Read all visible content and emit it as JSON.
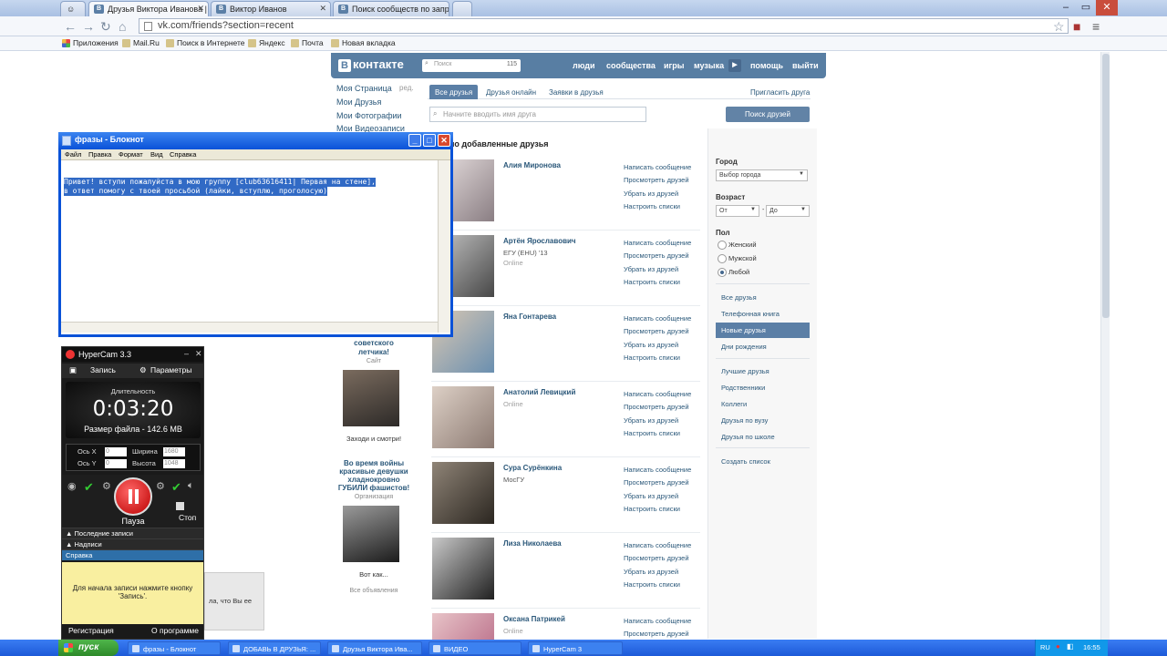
{
  "browser": {
    "tabs": [
      {
        "label": "Друзья Виктора Иванова |",
        "active": true
      },
      {
        "label": "Виктор Иванов",
        "active": false
      },
      {
        "label": "Поиск сообществ по запро",
        "active": false
      }
    ],
    "url": "vk.com/friends?section=recent",
    "bookmarks": [
      "Приложения",
      "Mail.Ru",
      "Поиск в Интернете",
      "Яндекс",
      "Почта",
      "Новая вкладка"
    ]
  },
  "vk": {
    "logo": "контакте",
    "logo_letter": "В",
    "search_placeholder": "Поиск",
    "search_count": "115",
    "nav": [
      "люди",
      "сообщества",
      "игры",
      "музыка",
      "помощь",
      "выйти"
    ],
    "left_menu": {
      "my_page": "Моя Страница",
      "edit": "ред.",
      "friends": "Мои Друзья",
      "photos": "Мои Фотографии",
      "videos": "Мои Видеозаписи"
    },
    "tabs": [
      "Все друзья",
      "Друзья онлайн",
      "Заявки в друзья"
    ],
    "invite": "Пригласить друга",
    "friend_search_placeholder": "Начните вводить имя друга",
    "search_button": "Поиск друзей",
    "recent_title": "но добавленные друзья",
    "actions": [
      "Написать сообщение",
      "Просмотреть друзей",
      "Убрать из друзей",
      "Настроить списки"
    ],
    "friends": [
      {
        "name": "Алия Миронова",
        "sub1": "",
        "sub2": ""
      },
      {
        "name": "Артён Ярославович",
        "sub1": "ЕГУ (EHU) '13",
        "sub2": "Online"
      },
      {
        "name": "Яна Гонтарева",
        "sub1": "",
        "sub2": ""
      },
      {
        "name": "Анатолий Левицкий",
        "sub1": "Online",
        "sub2": ""
      },
      {
        "name": "Сура Сурёнкина",
        "sub1": "МосГУ",
        "sub2": ""
      },
      {
        "name": "Лиза Николаева",
        "sub1": "",
        "sub2": ""
      },
      {
        "name": "Оксана Патрикей",
        "sub1": "Online",
        "sub2": ""
      }
    ],
    "filters": {
      "city_label": "Город",
      "city_value": "Выбор города",
      "age_label": "Возраст",
      "age_from": "От",
      "age_to": "До",
      "age_dash": "-",
      "sex_label": "Пол",
      "sex_options": [
        "Женский",
        "Мужской",
        "Любой"
      ],
      "sex_selected": "Любой",
      "categories_a": [
        "Все друзья",
        "Телефонная книга",
        "Новые друзья",
        "Дни рождения"
      ],
      "categories_b": [
        "Лучшие друзья",
        "Родственники",
        "Коллеги",
        "Друзья по вузу",
        "Друзья по школе"
      ],
      "create_list": "Создать список",
      "active_category": "Новые друзья"
    },
    "ads": {
      "ad1_title1": "советского",
      "ad1_title2": "летчика!",
      "ad1_sub": "Сайт",
      "ad1_link": "Заходи и смотри!",
      "ad2_title": "Во время войны красивые девушки хладнокровно ГУБИЛИ фашистов!",
      "ad2_sub": "Организация",
      "ad2_link": "Вот как...",
      "all_ads": "Все объявления"
    }
  },
  "notepad": {
    "title": "фразы - Блокнот",
    "menu": [
      "Файл",
      "Правка",
      "Формат",
      "Вид",
      "Справка"
    ],
    "line1": "Привет! вступи пожалуйста в мою группу [club63616411| Первая на стене],",
    "line2": "в ответ помогу с твоей просьбой (лайки, вступлю, проголосую)"
  },
  "hypercam": {
    "title": "HyperCam 3.3",
    "tab_record": "Запись",
    "tab_params": "Параметры",
    "duration_label": "Длительность",
    "timer": "0:03:20",
    "file_size": "Размер файла - 142.6 MB",
    "axis_x": "Ось X",
    "axis_y": "Ось Y",
    "x_value": "0",
    "y_value": "0",
    "width_label": "Ширина",
    "height_label": "Высота",
    "width_value": "1680",
    "height_value": "1048",
    "pause": "Пауза",
    "stop": "Стоп",
    "recent": "Последние записи",
    "captions": "Надписи",
    "help": "Справка",
    "hint": "Для начала записи нажмите кнопку 'Запись'.",
    "register": "Регистрация",
    "about": "О программе"
  },
  "tooltip_fragment": "ла, что Вы ее",
  "taskbar": {
    "start": "пуск",
    "tasks": [
      "фразы - Блокнот",
      "ДОБАВЬ В ДРУЗЬЯ: ...",
      "Друзья Виктора Ива...",
      "ВИДЕО",
      "HyperCam 3"
    ],
    "lang": "RU",
    "clock": "16:55"
  }
}
